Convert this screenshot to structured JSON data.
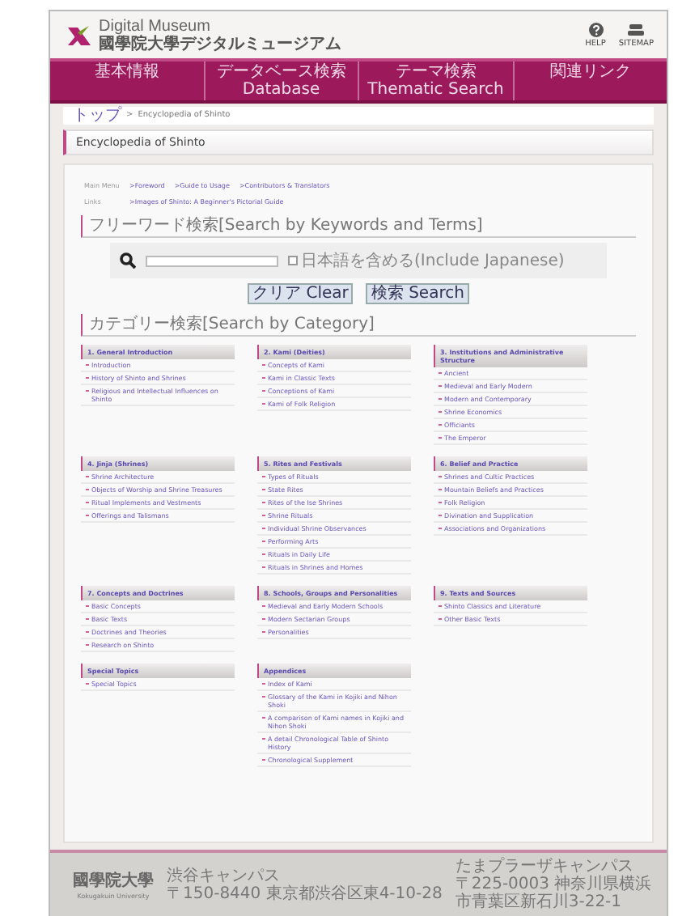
{
  "header": {
    "logo_title": "Digital Museum",
    "logo_subtitle": "國學院大學デジタルミュージアム",
    "icons": [
      {
        "kind": "help",
        "label": "HELP"
      },
      {
        "kind": "sitemap",
        "label": "SITEMAP"
      }
    ]
  },
  "nav": [
    "基本情報",
    "データベース検索 Database",
    "テーマ検索 Thematic Search",
    "関連リンク"
  ],
  "breadcrumb": {
    "separator": ">",
    "items": [
      "トップ",
      "Encyclopedia of Shinto"
    ]
  },
  "page_title": "Encyclopedia of Shinto",
  "menu_rows": [
    {
      "label": "Main Menu",
      "links": [
        ">Foreword",
        ">Guide to Usage",
        ">Contributors & Translators"
      ]
    },
    {
      "label": "Links",
      "links": [
        ">Images of Shinto: A Beginner's Pictorial Guide"
      ]
    }
  ],
  "keyword_search": {
    "heading": "フリーワード検索[Search by Keywords and Terms]",
    "checkbox_label": "日本語を含める(Include Japanese)",
    "checked": false,
    "buttons": [
      "クリア Clear",
      "検索 Search"
    ]
  },
  "category_heading": "カテゴリー検索[Search by Category]",
  "categories": [
    {
      "title": "1. General Introduction",
      "items": [
        "Introduction",
        "History of Shinto and Shrines",
        "Religious and Intellectual Influences on Shinto"
      ]
    },
    {
      "title": "2. Kami (Deities)",
      "items": [
        "Concepts of Kami",
        "Kami in Classic Texts",
        "Conceptions of Kami",
        "Kami of Folk Religion"
      ]
    },
    {
      "title": "3. Institutions and Administrative Structure",
      "items": [
        "Ancient",
        "Medieval and Early Modern",
        "Modern and Contemporary",
        "Shrine Economics",
        "Officiants",
        "The Emperor"
      ]
    },
    {
      "title": "4. Jinja (Shrines)",
      "items": [
        "Shrine Architecture",
        "Objects of Worship and Shrine Treasures",
        "Ritual Implements and Vestments",
        "Offerings and Talismans"
      ]
    },
    {
      "title": "5. Rites and Festivals",
      "items": [
        "Types of Rituals",
        "State Rites",
        "Rites of the Ise Shrines",
        "Shrine Rituals",
        "Individual Shrine Observances",
        "Performing Arts",
        "Rituals in Daily Life",
        "Rituals in Shrines and Homes"
      ]
    },
    {
      "title": "6. Belief and Practice",
      "items": [
        "Shrines and Cultic Practices",
        "Mountain Beliefs and Practices",
        "Folk Religion",
        "Divination and Supplication",
        "Associations and Organizations"
      ]
    },
    {
      "title": "7. Concepts and Doctrines",
      "items": [
        "Basic Concepts",
        "Basic Texts",
        "Doctrines and Theories",
        "Research on Shinto"
      ]
    },
    {
      "title": "8. Schools, Groups and Personalities",
      "items": [
        "Medieval and Early Modern Schools",
        "Modern Sectarian Groups",
        "Personalities"
      ]
    },
    {
      "title": "9. Texts and Sources",
      "items": [
        "Shinto Classics and Literature",
        "Other Basic Texts"
      ]
    },
    {
      "title": "Special Topics",
      "items": [
        "Special Topics"
      ]
    },
    {
      "title": "Appendices",
      "items": [
        "Index of Kami",
        "Glossary of the Kami in Kojiki and Nihon Shoki",
        "A comparison of Kami names in Kojiki and Nihon Shoki",
        "A detail Chronological Table of Shinto History",
        "Chronological Supplement"
      ]
    }
  ],
  "footer": {
    "university": "國學院大學",
    "university_en": "Kokugakuin University",
    "campuses": [
      {
        "name": "渋谷キャンパス",
        "address": "〒150-8440 東京都渋谷区東4-10-28"
      },
      {
        "name": "たまプラーザキャンパス",
        "address": "〒225-0003 神奈川県横浜市青葉区新石川3-22-1"
      }
    ]
  }
}
